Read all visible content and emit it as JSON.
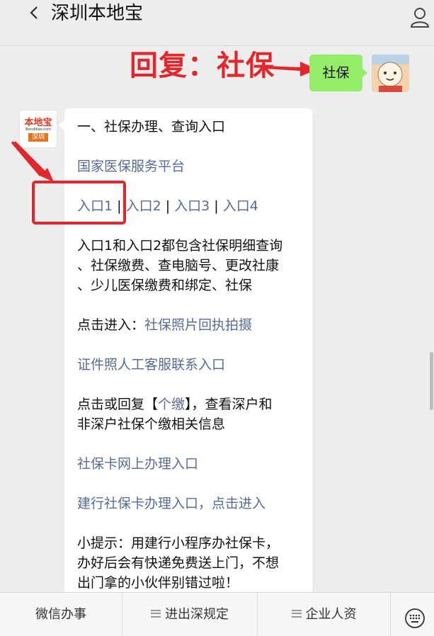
{
  "header": {
    "title": "深圳本地宝"
  },
  "annotation": {
    "text": "回复：社保"
  },
  "sent_message": {
    "text": "社保"
  },
  "received": {
    "logo": {
      "name": "本地宝",
      "domain": "Bendibao.com",
      "tag": "深圳"
    },
    "line1": "一、社保办理、查询入口",
    "line2": "国家医保服务平台",
    "entries": [
      "入口1",
      "入口2",
      "入口3",
      "入口4"
    ],
    "separator": " | ",
    "para1": [
      "入口1和入口2都包含社保明细查询",
      "、社保缴费、查电脑号、更改社康",
      "、少儿医保缴费和绑定、社保"
    ],
    "click_prefix": "点击进入：",
    "click_link": "社保照片回执拍摄",
    "link_id_service": "证件照人工客服联系入口",
    "para2_a": "点击或回复【",
    "para2_link": "个缴",
    "para2_b": "】，查看深户和",
    "para2_c": "非深户社保个缴相关信息",
    "link_card_online": "社保卡网上办理入口",
    "link_ccb": "建行社保卡办理入口，点击进入",
    "tip": [
      "小提示：用建行小程序办社保卡，",
      "办好后会有快递免费送上门，不想",
      "出门拿的小伙伴别错过啦！"
    ]
  },
  "bottom_bar": {
    "items": [
      "微信办事",
      "进出深规定",
      "企业人资"
    ]
  },
  "colors": {
    "accent_red": "#e3262b",
    "link_blue": "#576b95",
    "bubble_green": "#95ec69"
  }
}
